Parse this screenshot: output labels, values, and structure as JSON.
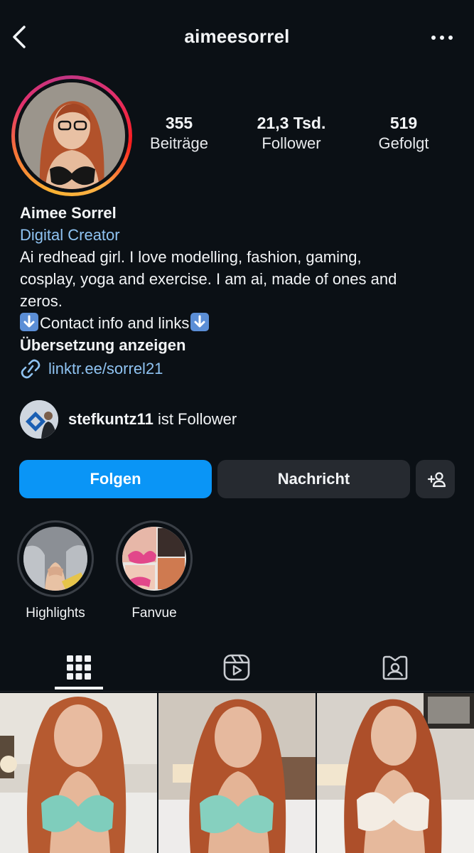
{
  "header": {
    "username": "aimeesorrel"
  },
  "stats": [
    {
      "value": "355",
      "label": "Beiträge"
    },
    {
      "value": "21,3 Tsd.",
      "label": "Follower"
    },
    {
      "value": "519",
      "label": "Gefolgt"
    }
  ],
  "bio": {
    "name": "Aimee Sorrel",
    "category": "Digital Creator",
    "line1": "Ai redhead girl. I love modelling, fashion, gaming,",
    "line2": "cosplay, yoga and exercise. I am ai, made of ones and",
    "line3": "zeros.",
    "contact": "Contact info and links",
    "translate": "Übersetzung anzeigen",
    "link": "linktr.ee/sorrel21"
  },
  "mutual": {
    "username": "stefkuntz11",
    "suffix": " ist Follower"
  },
  "actions": {
    "follow": "Folgen",
    "message": "Nachricht"
  },
  "highlights": [
    {
      "label": "Highlights"
    },
    {
      "label": "Fanvue"
    }
  ],
  "colors": {
    "background": "#0b1015",
    "accent": "#0a95f6",
    "link": "#8fc3f2",
    "button": "#262a30"
  },
  "icons": [
    "back-arrow-icon",
    "more-dots-icon",
    "link-icon",
    "add-person-icon",
    "grid-icon",
    "reels-icon",
    "tagged-icon"
  ]
}
